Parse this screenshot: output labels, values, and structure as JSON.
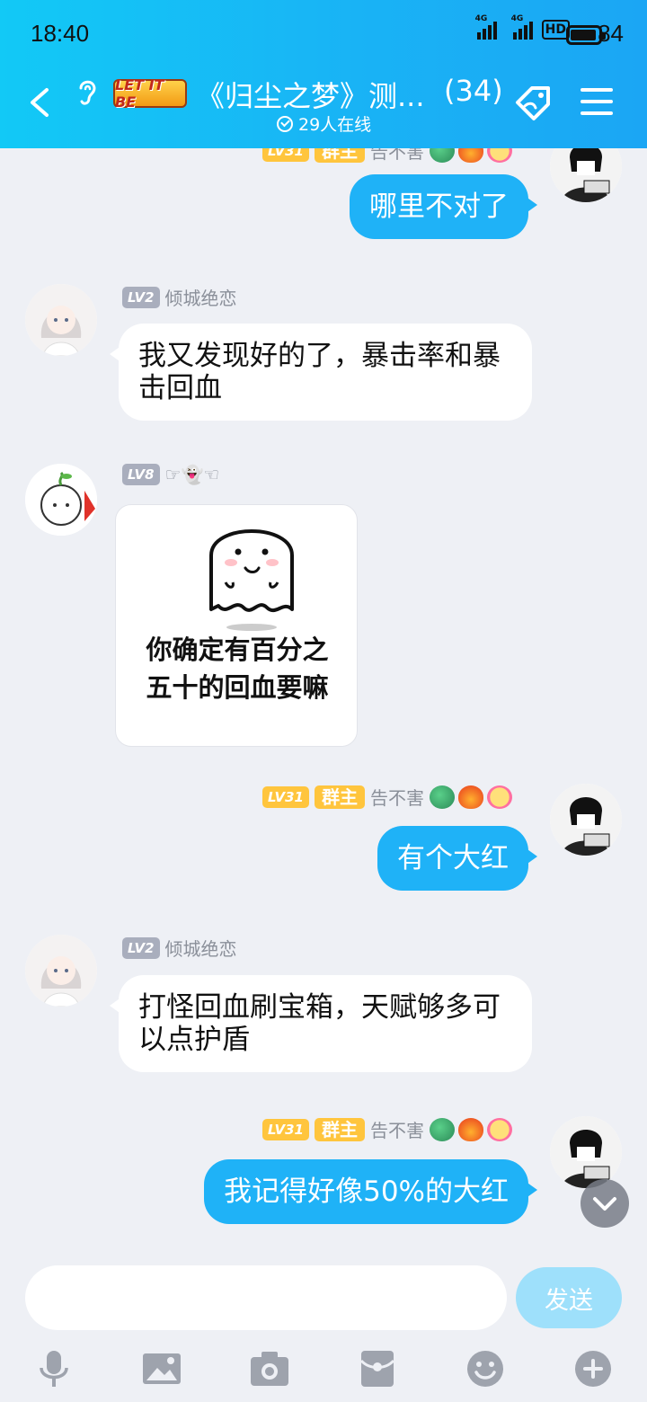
{
  "status_bar": {
    "time": "18:40",
    "network_tag": "4G",
    "hd_label": "HD",
    "battery": "84"
  },
  "header": {
    "badge": "LET IT BE",
    "title": "《归尘之梦》测...",
    "member_count": "(34)",
    "online": "29人在线"
  },
  "messages": [
    {
      "side": "right",
      "level": "LV31",
      "role": "群主",
      "name": "告不害",
      "text": "哪里不对了"
    },
    {
      "side": "left",
      "level": "LV2",
      "name": "倾城绝恋",
      "text": "我又发现好的了，暴击率和暴击回血"
    },
    {
      "side": "left",
      "level": "LV8",
      "name": "☞👻☜",
      "sticker_text": "你确定有百分之五十的回血要嘛"
    },
    {
      "side": "right",
      "level": "LV31",
      "role": "群主",
      "name": "告不害",
      "text": "有个大红"
    },
    {
      "side": "left",
      "level": "LV2",
      "name": "倾城绝恋",
      "text": "打怪回血刷宝箱，天赋够多可以点护盾"
    },
    {
      "side": "right",
      "level": "LV31",
      "role": "群主",
      "name": "告不害",
      "text": "我记得好像50%的大红"
    }
  ],
  "input": {
    "placeholder": "",
    "send_label": "发送"
  },
  "toolbar_icons": [
    "microphone-icon",
    "image-icon",
    "camera-icon",
    "red-packet-icon",
    "emoji-icon",
    "plus-icon"
  ],
  "colors": {
    "header_gradient_start": "#12c9f6",
    "header_gradient_end": "#1ba6f4",
    "bubble_right": "#1fb2f7",
    "background": "#eef0f5",
    "owner_badge": "#ffc53d"
  }
}
